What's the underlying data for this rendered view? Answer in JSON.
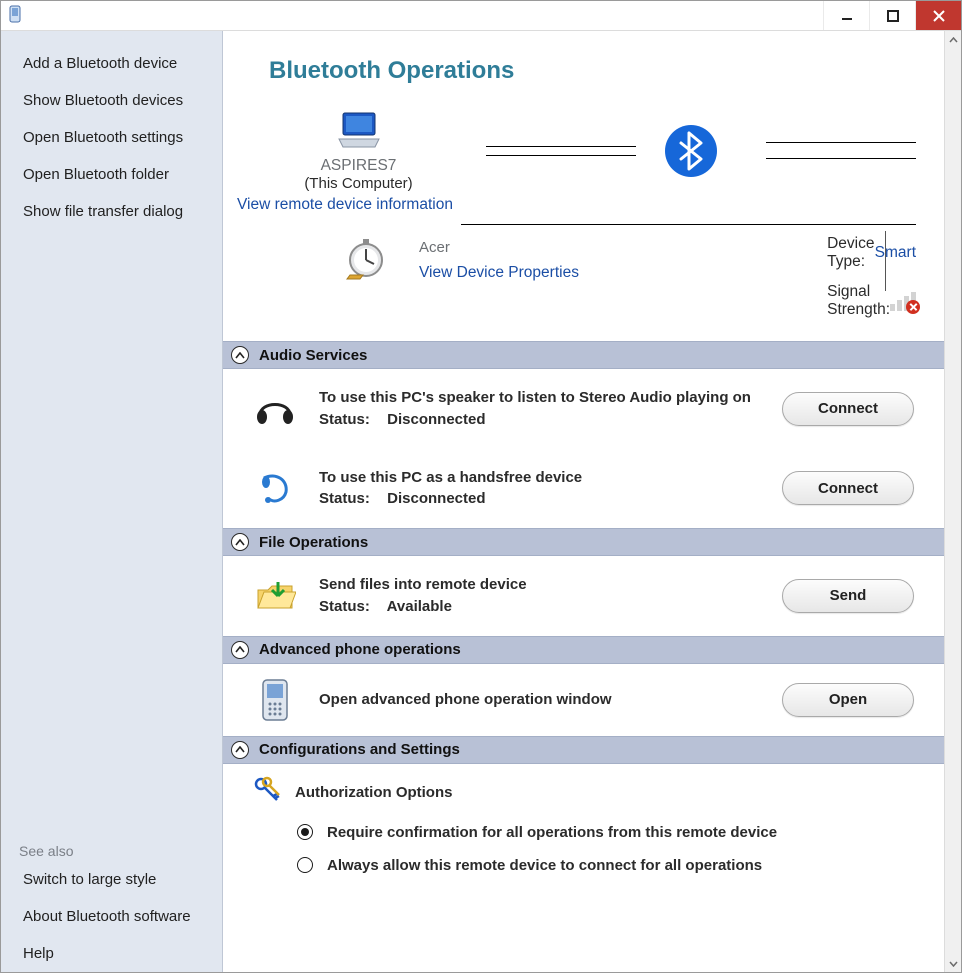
{
  "window": {
    "app_icon": "phone-icon"
  },
  "sidebar": {
    "items": [
      {
        "label": "Add a Bluetooth device"
      },
      {
        "label": "Show Bluetooth devices"
      },
      {
        "label": "Open Bluetooth settings"
      },
      {
        "label": "Open Bluetooth folder"
      },
      {
        "label": "Show file transfer dialog"
      }
    ],
    "see_also_label": "See also",
    "see_also": [
      {
        "label": "Switch to large style"
      },
      {
        "label": "About Bluetooth software"
      },
      {
        "label": "Help"
      }
    ]
  },
  "main": {
    "title": "Bluetooth Operations",
    "local_device": {
      "name": "ASPIRES7",
      "note": "(This Computer)"
    },
    "view_remote_link": "View remote device information",
    "remote": {
      "brand": "Acer",
      "properties_link": "View Device Properties",
      "type_label": "Device Type:",
      "type_value": "Smart",
      "signal_label": "Signal Strength:"
    }
  },
  "sections": {
    "audio": {
      "header": "Audio Services",
      "items": [
        {
          "desc": "To use this PC's speaker to listen to Stereo Audio playing on",
          "status_label": "Status:",
          "status_value": "Disconnected",
          "button": "Connect"
        },
        {
          "desc": "To use this PC as a handsfree device",
          "status_label": "Status:",
          "status_value": "Disconnected",
          "button": "Connect"
        }
      ]
    },
    "file": {
      "header": "File Operations",
      "item": {
        "desc": "Send files into remote device",
        "status_label": "Status:",
        "status_value": "Available",
        "button": "Send"
      }
    },
    "phone": {
      "header": "Advanced phone operations",
      "item": {
        "desc": "Open advanced phone operation window",
        "button": "Open"
      }
    },
    "config": {
      "header": "Configurations and Settings",
      "auth_heading": "Authorization Options",
      "options": [
        {
          "label": "Require confirmation for all operations from this remote device",
          "checked": true
        },
        {
          "label": "Always allow this remote device to connect for all operations",
          "checked": false
        }
      ]
    }
  }
}
